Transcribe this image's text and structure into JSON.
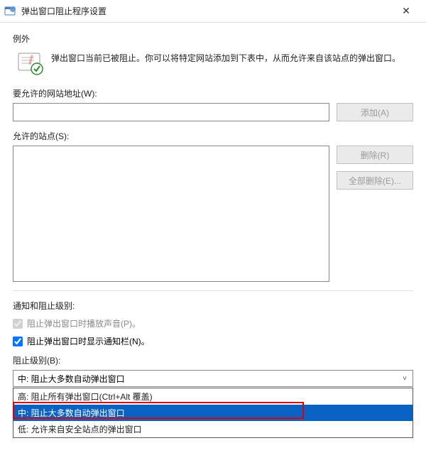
{
  "titlebar": {
    "title": "弹出窗口阻止程序设置",
    "close_label": "✕"
  },
  "exceptions": {
    "section_label": "例外",
    "info_text": "弹出窗口当前已被阻止。你可以将特定网站添加到下表中，从而允许来自该站点的弹出窗口。",
    "address_label": "要允许的网站地址(W):",
    "add_button": "添加(A)",
    "allowed_label": "允许的站点(S):",
    "remove_button": "删除(R)",
    "remove_all_button": "全部删除(E)..."
  },
  "notifications": {
    "section_label": "通知和阻止级别:",
    "checkbox_sound": "阻止弹出窗口时播放声音(P)。",
    "checkbox_notify": "阻止弹出窗口时显示通知栏(N)。",
    "block_level_label": "阻止级别(B):",
    "selected_value": "中: 阻止大多数自动弹出窗口",
    "options": [
      "高: 阻止所有弹出窗口(Ctrl+Alt 覆盖)",
      "中: 阻止大多数自动弹出窗口",
      "低: 允许来自安全站点的弹出窗口"
    ]
  }
}
